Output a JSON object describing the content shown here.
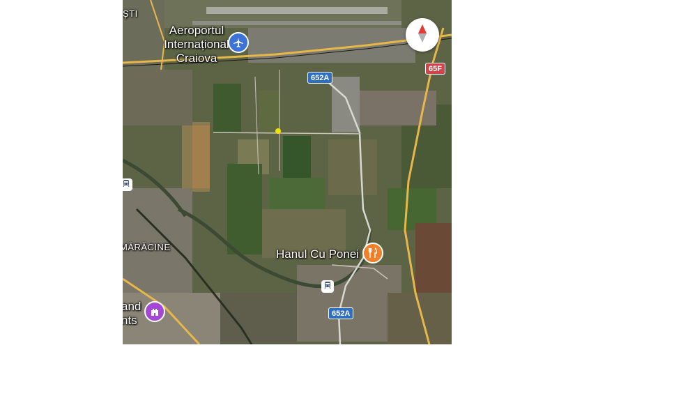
{
  "map": {
    "labels": {
      "top_left_fragment": "ȘTI",
      "airport": "Aeroportul\nInternațional\nCraiova",
      "restaurant": "Hanul Cu Ponei",
      "village": "MĂRĂCINE",
      "attraction_fragment": "and\nnts"
    },
    "road_shields": {
      "upper_652a": "652A",
      "lower_652a": "652A",
      "route_65f": "65F"
    },
    "icons": {
      "airport": "airplane-icon",
      "restaurant": "fork-knife-icon",
      "attraction": "castle-icon",
      "transit": "train-icon",
      "compass": "compass-icon"
    },
    "colors": {
      "airport_pin": "#3b73d8",
      "restaurant_pin": "#f0802a",
      "attraction_pin": "#a347d4",
      "shield_blue": "#2f6fc2",
      "shield_red": "#d1454a",
      "main_road": "#e8b74a"
    }
  }
}
